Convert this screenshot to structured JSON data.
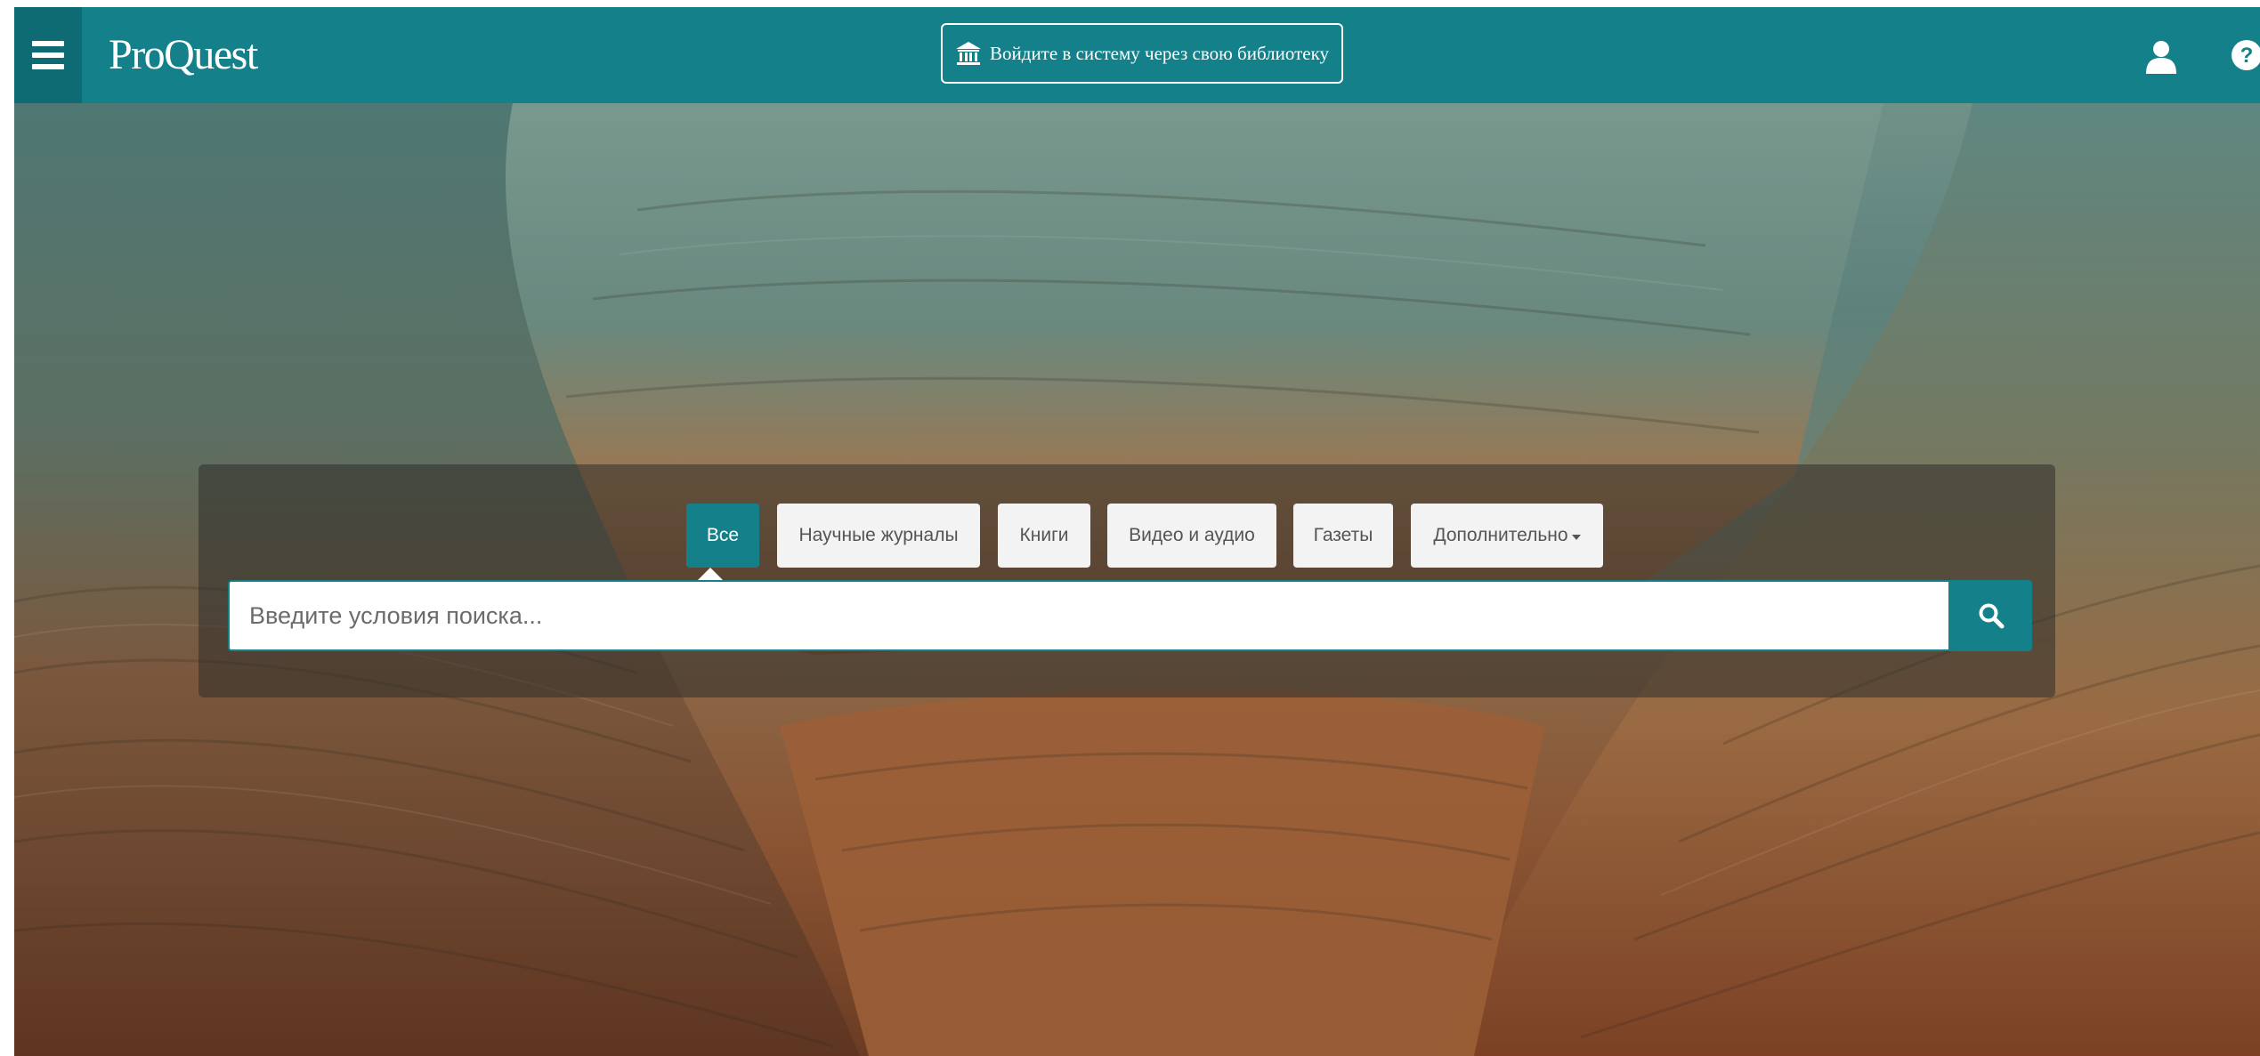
{
  "header": {
    "logo": "ProQuest",
    "login_label": "Войдите в систему через свою библиотеку",
    "icons": {
      "menu": "hamburger-menu-icon",
      "library": "library-building-icon",
      "user": "user-icon",
      "help": "help-icon"
    }
  },
  "search": {
    "tabs": [
      {
        "label": "Все",
        "active": true
      },
      {
        "label": "Научные журналы",
        "active": false
      },
      {
        "label": "Книги",
        "active": false
      },
      {
        "label": "Видео и аудио",
        "active": false
      },
      {
        "label": "Газеты",
        "active": false
      },
      {
        "label": "Дополнительно",
        "active": false,
        "dropdown": true
      }
    ],
    "placeholder": "Введите условия поиска...",
    "button_icon": "search-icon"
  },
  "colors": {
    "brand": "#13808a",
    "brand_dark": "#0e6b74",
    "tab_bg": "#f3f3f3",
    "tab_text": "#555555"
  }
}
